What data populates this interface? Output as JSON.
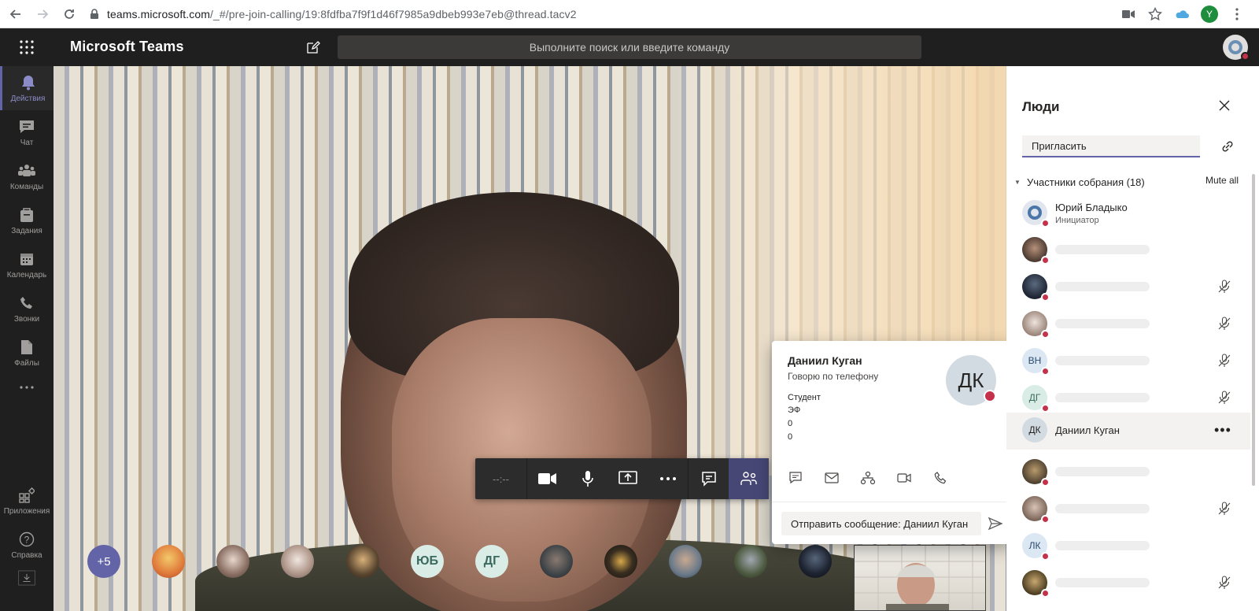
{
  "browser": {
    "url_host": "teams.microsoft.com",
    "url_path": "/_#/pre-join-calling/19:8fdfba7f9f1d46f7985a9dbeb993e7eb@thread.tacv2",
    "profile_initial": "Y"
  },
  "header": {
    "app_title": "Microsoft Teams",
    "search_placeholder": "Выполните поиск или введите команду"
  },
  "rail": {
    "items": [
      {
        "label": "Действия",
        "icon": "bell-icon"
      },
      {
        "label": "Чат",
        "icon": "chat-icon"
      },
      {
        "label": "Команды",
        "icon": "teams-icon"
      },
      {
        "label": "Задания",
        "icon": "assignments-icon"
      },
      {
        "label": "Календарь",
        "icon": "calendar-icon"
      },
      {
        "label": "Звонки",
        "icon": "phone-icon"
      },
      {
        "label": "Файлы",
        "icon": "files-icon"
      }
    ],
    "apps_label": "Приложения",
    "help_label": "Справка"
  },
  "call_bar": {
    "timer": "--:--"
  },
  "participants_strip": {
    "more_label": "+5",
    "initials": [
      "ЮБ",
      "ДГ"
    ]
  },
  "contact_card": {
    "name": "Даниил Куган",
    "status": "Говорю по телефону",
    "lines": [
      "Студент",
      "ЭФ",
      "0",
      "0"
    ],
    "initials": "ДК",
    "message_placeholder": "Отправить сообщение: Даниил Куган"
  },
  "people_panel": {
    "title": "Люди",
    "invite_placeholder": "Пригласить",
    "section_label": "Участники собрания (18)",
    "mute_all": "Mute all",
    "organizer": {
      "name": "Юрий Бладыко",
      "role": "Инициатор"
    },
    "highlighted": {
      "name": "Даниил Куган",
      "initials": "ДК"
    },
    "partial_initials": [
      "ВН",
      "ДГ",
      "ЛК"
    ]
  },
  "colors": {
    "accent": "#6264a7",
    "status_busy": "#c4314b",
    "header_bg": "#1f1f1f"
  }
}
